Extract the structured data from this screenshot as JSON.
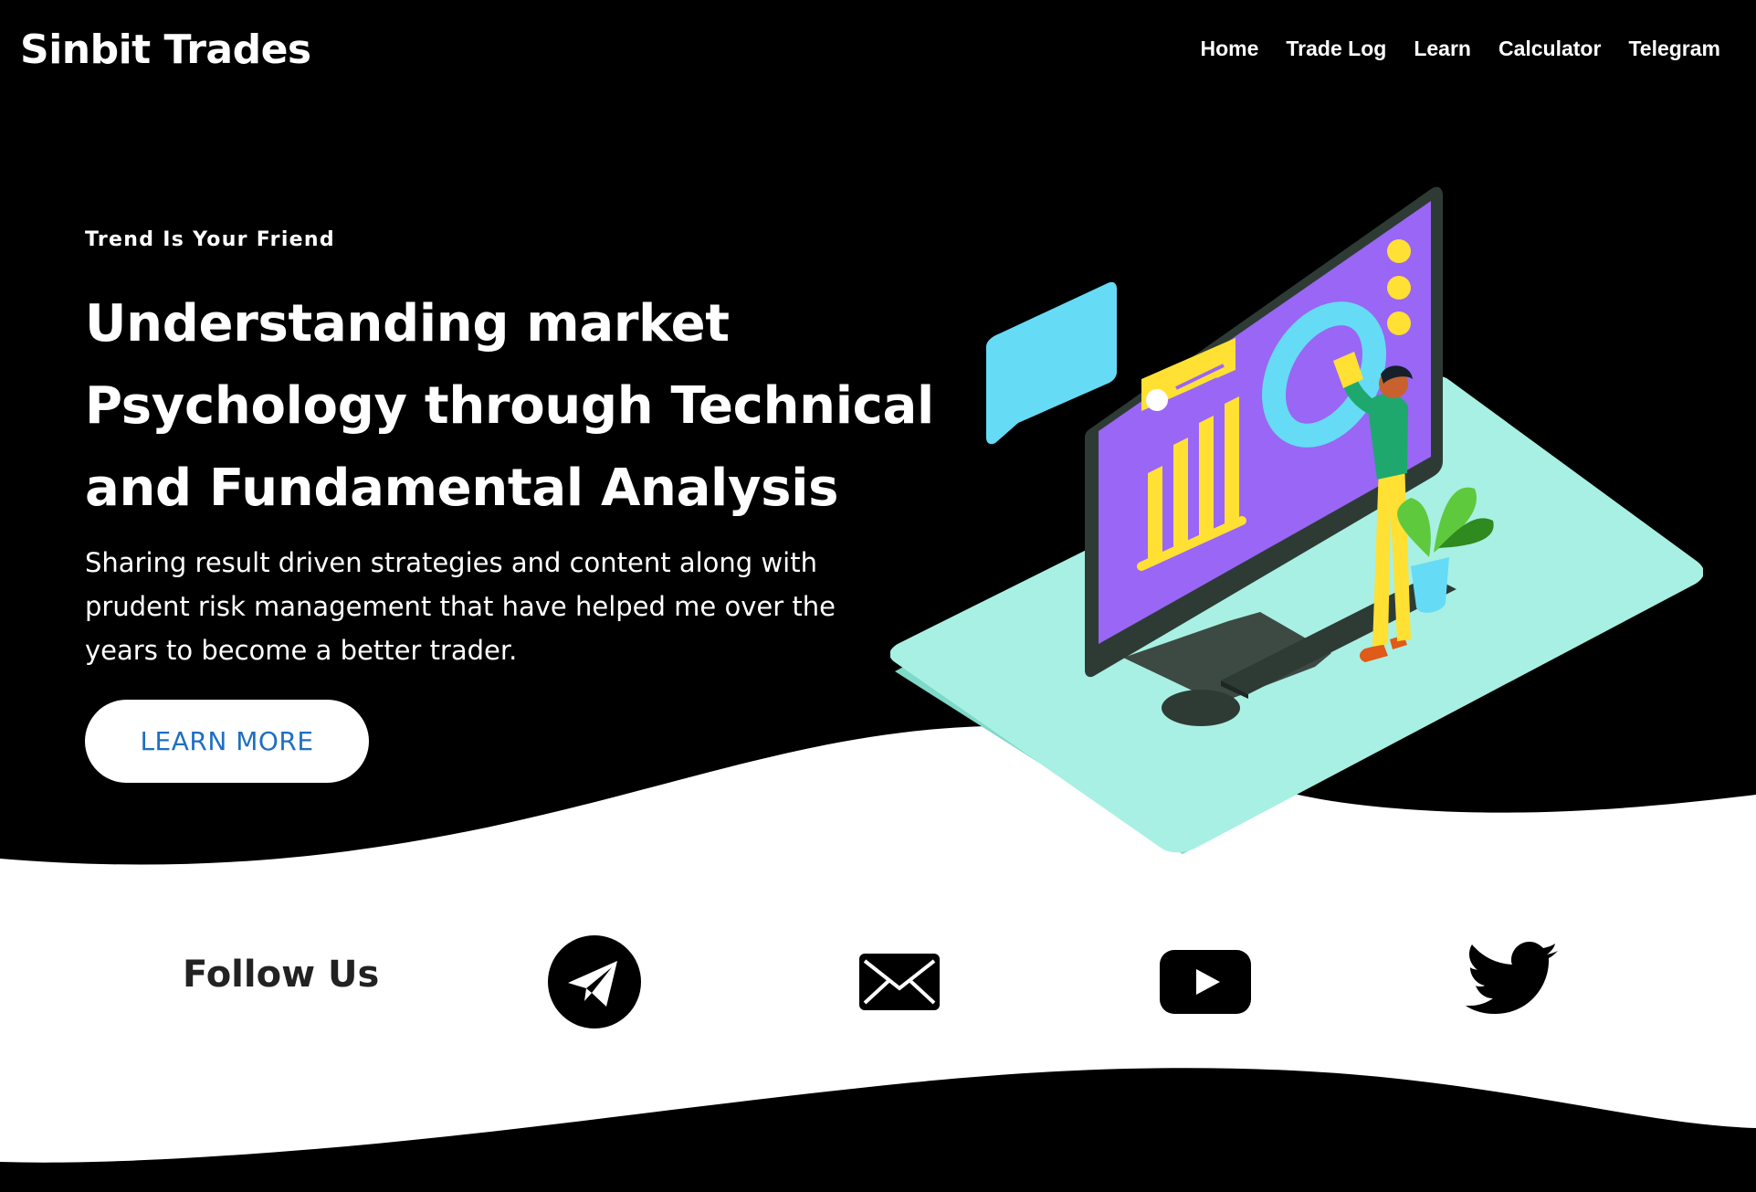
{
  "brand": {
    "name": "Sinbit Trades"
  },
  "nav": {
    "items": [
      {
        "label": "Home"
      },
      {
        "label": "Trade Log"
      },
      {
        "label": "Learn"
      },
      {
        "label": "Calculator"
      },
      {
        "label": "Telegram"
      }
    ]
  },
  "hero": {
    "eyebrow": "Trend Is Your Friend",
    "title_lines": [
      "Understanding market",
      "Psychology through Technical",
      "and Fundamental Analysis"
    ],
    "description_lines": [
      "Sharing result driven strategies and content along with",
      "prudent risk management that have helped me over the",
      "years to become a better trader."
    ],
    "cta_label": "LEARN MORE"
  },
  "follow": {
    "label": "Follow Us",
    "icons": [
      "telegram-icon",
      "mail-icon",
      "youtube-icon",
      "twitter-icon"
    ]
  },
  "colors": {
    "background": "#000000",
    "wave": "#ffffff",
    "cta_text": "#1e6fc2",
    "screen_purple": "#9966f5",
    "platform_mint": "#a8f0e4",
    "accent_yellow": "#ffe033",
    "chat_blue": "#66dbf5",
    "figure_green": "#1fa86e"
  }
}
